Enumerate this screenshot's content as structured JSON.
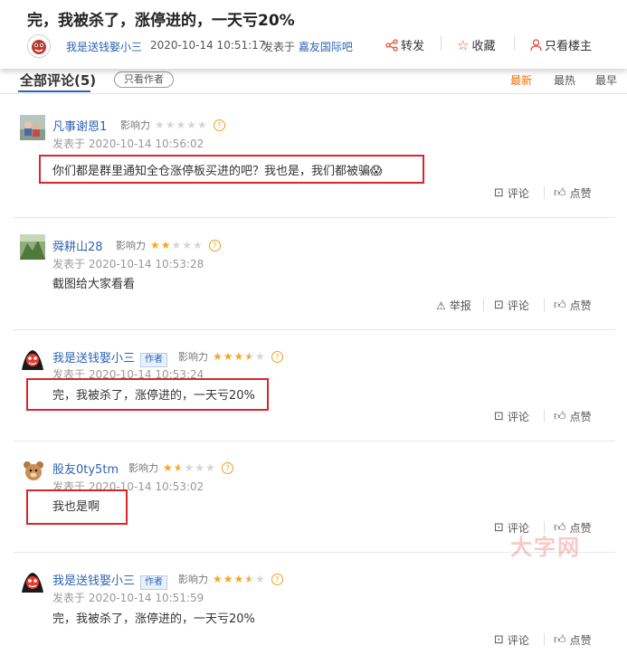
{
  "post": {
    "title": "完，我被杀了，涨停进的，一天亏20%",
    "author": "我是送钱娶小三",
    "time": "2020-10-14 10:51:17",
    "from_prefix": "发表于",
    "from_forum": "嘉友国际吧",
    "actions": {
      "share": "转发",
      "favorite": "收藏",
      "only_op": "只看楼主"
    }
  },
  "tabs": {
    "all_label": "全部评论(5)",
    "only_author": "只看作者",
    "sort": [
      "最新",
      "最热",
      "最早"
    ],
    "active_sort": "最新"
  },
  "labels": {
    "influence": "影响力",
    "reply": "评论",
    "like": "点赞",
    "report": "举报",
    "author_badge": "作者"
  },
  "comments": [
    {
      "user": "凡事谢恩1",
      "stars": 0,
      "time": "发表于 2020-10-14 10:56:02",
      "text": "你们都是群里通知全仓涨停板买进的吧？我也是，我们都被骗😱"
    },
    {
      "user": "舜耕山28",
      "stars": 2,
      "time": "发表于 2020-10-14 10:53:28",
      "text": "截图给大家看看"
    },
    {
      "user": "我是送钱娶小三",
      "stars": 3.5,
      "is_author": true,
      "time": "发表于 2020-10-14 10:53:24",
      "text": "完，我被杀了，涨停进的，一天亏20%"
    },
    {
      "user": "股友0ty5tm",
      "stars": 1.5,
      "time": "发表于 2020-10-14 10:53:02",
      "text": "我也是啊"
    },
    {
      "user": "我是送钱娶小三",
      "stars": 3.5,
      "is_author": true,
      "time": "发表于 2020-10-14 10:51:59",
      "text": "完，我被杀了，涨停进的，一天亏20%"
    }
  ],
  "watermark": "大字网",
  "colors": {
    "link": "#2d64b3",
    "accent": "#ff6a00",
    "highlight": "#d9262c",
    "star": "#f6a623"
  }
}
